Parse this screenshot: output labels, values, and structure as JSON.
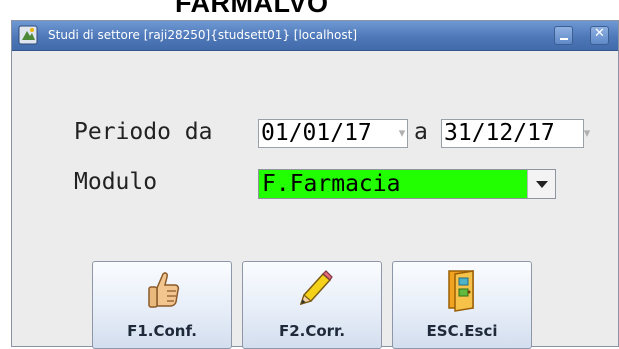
{
  "header_overflow_text": "FARMALVO",
  "window": {
    "title": "Studi di settore [raji28250]{studsett01} [localhost]",
    "minimize_glyph": "_",
    "close_glyph": "✕"
  },
  "form": {
    "periodo_label": "Periodo da",
    "date_from": "01/01/17",
    "a_label": "a",
    "date_to": "31/12/17",
    "modulo_label": "Modulo",
    "modulo_value": "F.Farmacia"
  },
  "buttons": {
    "confirm_label": "F1.Conf.",
    "correct_label": "F2.Corr.",
    "exit_label": "ESC.Esci"
  },
  "colors": {
    "titlebar": "#4e78b8",
    "modulo_highlight": "#22ff00",
    "window_bg": "#ececec"
  },
  "icons": {
    "app": "app-icon",
    "confirm": "thumbs-up-icon",
    "correct": "pencil-icon",
    "exit": "exit-door-icon"
  }
}
